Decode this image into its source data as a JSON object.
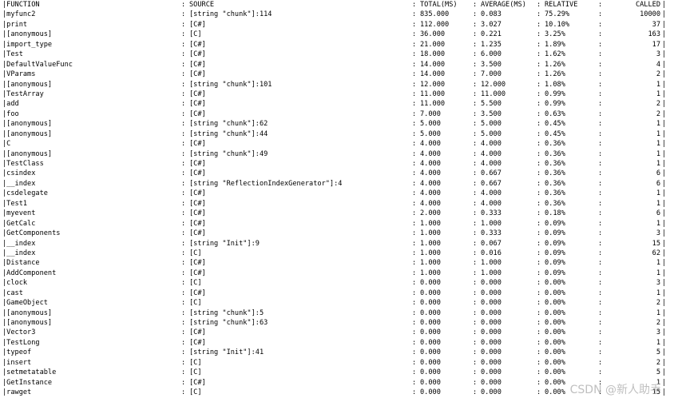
{
  "separator": ":",
  "edge": "|",
  "header": {
    "function": "|FUNCTION",
    "source": "SOURCE",
    "total": "TOTAL(MS)",
    "average": "AVERAGE(MS)",
    "relative": "RELATIVE",
    "called": "CALLED"
  },
  "rows": [
    {
      "fn": "|myfunc2",
      "src": "[string \"chunk\"]:114",
      "total": "835.000",
      "avg": "0.083",
      "rel": "75.29%",
      "called": "10000"
    },
    {
      "fn": "|print",
      "src": "[C#]",
      "total": "112.000",
      "avg": "3.027",
      "rel": "10.10%",
      "called": "37"
    },
    {
      "fn": "|[anonymous]",
      "src": "[C]",
      "total": "36.000",
      "avg": "0.221",
      "rel": "3.25%",
      "called": "163"
    },
    {
      "fn": "|import_type",
      "src": "[C#]",
      "total": "21.000",
      "avg": "1.235",
      "rel": "1.89%",
      "called": "17"
    },
    {
      "fn": "|Test",
      "src": "[C#]",
      "total": "18.000",
      "avg": "6.000",
      "rel": "1.62%",
      "called": "3"
    },
    {
      "fn": "|DefaultValueFunc",
      "src": "[C#]",
      "total": "14.000",
      "avg": "3.500",
      "rel": "1.26%",
      "called": "4"
    },
    {
      "fn": "|VParams",
      "src": "[C#]",
      "total": "14.000",
      "avg": "7.000",
      "rel": "1.26%",
      "called": "2"
    },
    {
      "fn": "|[anonymous]",
      "src": "[string \"chunk\"]:101",
      "total": "12.000",
      "avg": "12.000",
      "rel": "1.08%",
      "called": "1"
    },
    {
      "fn": "|TestArray",
      "src": "[C#]",
      "total": "11.000",
      "avg": "11.000",
      "rel": "0.99%",
      "called": "1"
    },
    {
      "fn": "|add",
      "src": "[C#]",
      "total": "11.000",
      "avg": "5.500",
      "rel": "0.99%",
      "called": "2"
    },
    {
      "fn": "|foo",
      "src": "[C#]",
      "total": "7.000",
      "avg": "3.500",
      "rel": "0.63%",
      "called": "2"
    },
    {
      "fn": "|[anonymous]",
      "src": "[string \"chunk\"]:62",
      "total": "5.000",
      "avg": "5.000",
      "rel": "0.45%",
      "called": "1"
    },
    {
      "fn": "|[anonymous]",
      "src": "[string \"chunk\"]:44",
      "total": "5.000",
      "avg": "5.000",
      "rel": "0.45%",
      "called": "1"
    },
    {
      "fn": "|C",
      "src": "[C#]",
      "total": "4.000",
      "avg": "4.000",
      "rel": "0.36%",
      "called": "1"
    },
    {
      "fn": "|[anonymous]",
      "src": "[string \"chunk\"]:49",
      "total": "4.000",
      "avg": "4.000",
      "rel": "0.36%",
      "called": "1"
    },
    {
      "fn": "|TestClass",
      "src": "[C#]",
      "total": "4.000",
      "avg": "4.000",
      "rel": "0.36%",
      "called": "1"
    },
    {
      "fn": "|csindex",
      "src": "[C#]",
      "total": "4.000",
      "avg": "0.667",
      "rel": "0.36%",
      "called": "6"
    },
    {
      "fn": "|__index",
      "src": "[string \"ReflectionIndexGenerator\"]:4",
      "total": "4.000",
      "avg": "0.667",
      "rel": "0.36%",
      "called": "6"
    },
    {
      "fn": "|csdelegate",
      "src": "[C#]",
      "total": "4.000",
      "avg": "4.000",
      "rel": "0.36%",
      "called": "1"
    },
    {
      "fn": "|Test1",
      "src": "[C#]",
      "total": "4.000",
      "avg": "4.000",
      "rel": "0.36%",
      "called": "1"
    },
    {
      "fn": "|myevent",
      "src": "[C#]",
      "total": "2.000",
      "avg": "0.333",
      "rel": "0.18%",
      "called": "6"
    },
    {
      "fn": "|GetCalc",
      "src": "[C#]",
      "total": "1.000",
      "avg": "1.000",
      "rel": "0.09%",
      "called": "1"
    },
    {
      "fn": "|GetComponents",
      "src": "[C#]",
      "total": "1.000",
      "avg": "0.333",
      "rel": "0.09%",
      "called": "3"
    },
    {
      "fn": "|__index",
      "src": "[string \"Init\"]:9",
      "total": "1.000",
      "avg": "0.067",
      "rel": "0.09%",
      "called": "15"
    },
    {
      "fn": "|__index",
      "src": "[C]",
      "total": "1.000",
      "avg": "0.016",
      "rel": "0.09%",
      "called": "62"
    },
    {
      "fn": "|Distance",
      "src": "[C#]",
      "total": "1.000",
      "avg": "1.000",
      "rel": "0.09%",
      "called": "1"
    },
    {
      "fn": "|AddComponent",
      "src": "[C#]",
      "total": "1.000",
      "avg": "1.000",
      "rel": "0.09%",
      "called": "1"
    },
    {
      "fn": "|clock",
      "src": "[C]",
      "total": "0.000",
      "avg": "0.000",
      "rel": "0.00%",
      "called": "3"
    },
    {
      "fn": "|cast",
      "src": "[C#]",
      "total": "0.000",
      "avg": "0.000",
      "rel": "0.00%",
      "called": "1"
    },
    {
      "fn": "|GameObject",
      "src": "[C]",
      "total": "0.000",
      "avg": "0.000",
      "rel": "0.00%",
      "called": "2"
    },
    {
      "fn": "|[anonymous]",
      "src": "[string \"chunk\"]:5",
      "total": "0.000",
      "avg": "0.000",
      "rel": "0.00%",
      "called": "1"
    },
    {
      "fn": "|[anonymous]",
      "src": "[string \"chunk\"]:63",
      "total": "0.000",
      "avg": "0.000",
      "rel": "0.00%",
      "called": "2"
    },
    {
      "fn": "|Vector3",
      "src": "[C#]",
      "total": "0.000",
      "avg": "0.000",
      "rel": "0.00%",
      "called": "3"
    },
    {
      "fn": "|TestLong",
      "src": "[C#]",
      "total": "0.000",
      "avg": "0.000",
      "rel": "0.00%",
      "called": "1"
    },
    {
      "fn": "|typeof",
      "src": "[string \"Init\"]:41",
      "total": "0.000",
      "avg": "0.000",
      "rel": "0.00%",
      "called": "5"
    },
    {
      "fn": "|insert",
      "src": "[C]",
      "total": "0.000",
      "avg": "0.000",
      "rel": "0.00%",
      "called": "2"
    },
    {
      "fn": "|setmetatable",
      "src": "[C]",
      "total": "0.000",
      "avg": "0.000",
      "rel": "0.00%",
      "called": "5"
    },
    {
      "fn": "|GetInstance",
      "src": "[C#]",
      "total": "0.000",
      "avg": "0.000",
      "rel": "0.00%",
      "called": "1"
    },
    {
      "fn": "|rawget",
      "src": "[C]",
      "total": "0.000",
      "avg": "0.000",
      "rel": "0.00%",
      "called": "15"
    }
  ],
  "watermark": "CSDN @新人助手"
}
